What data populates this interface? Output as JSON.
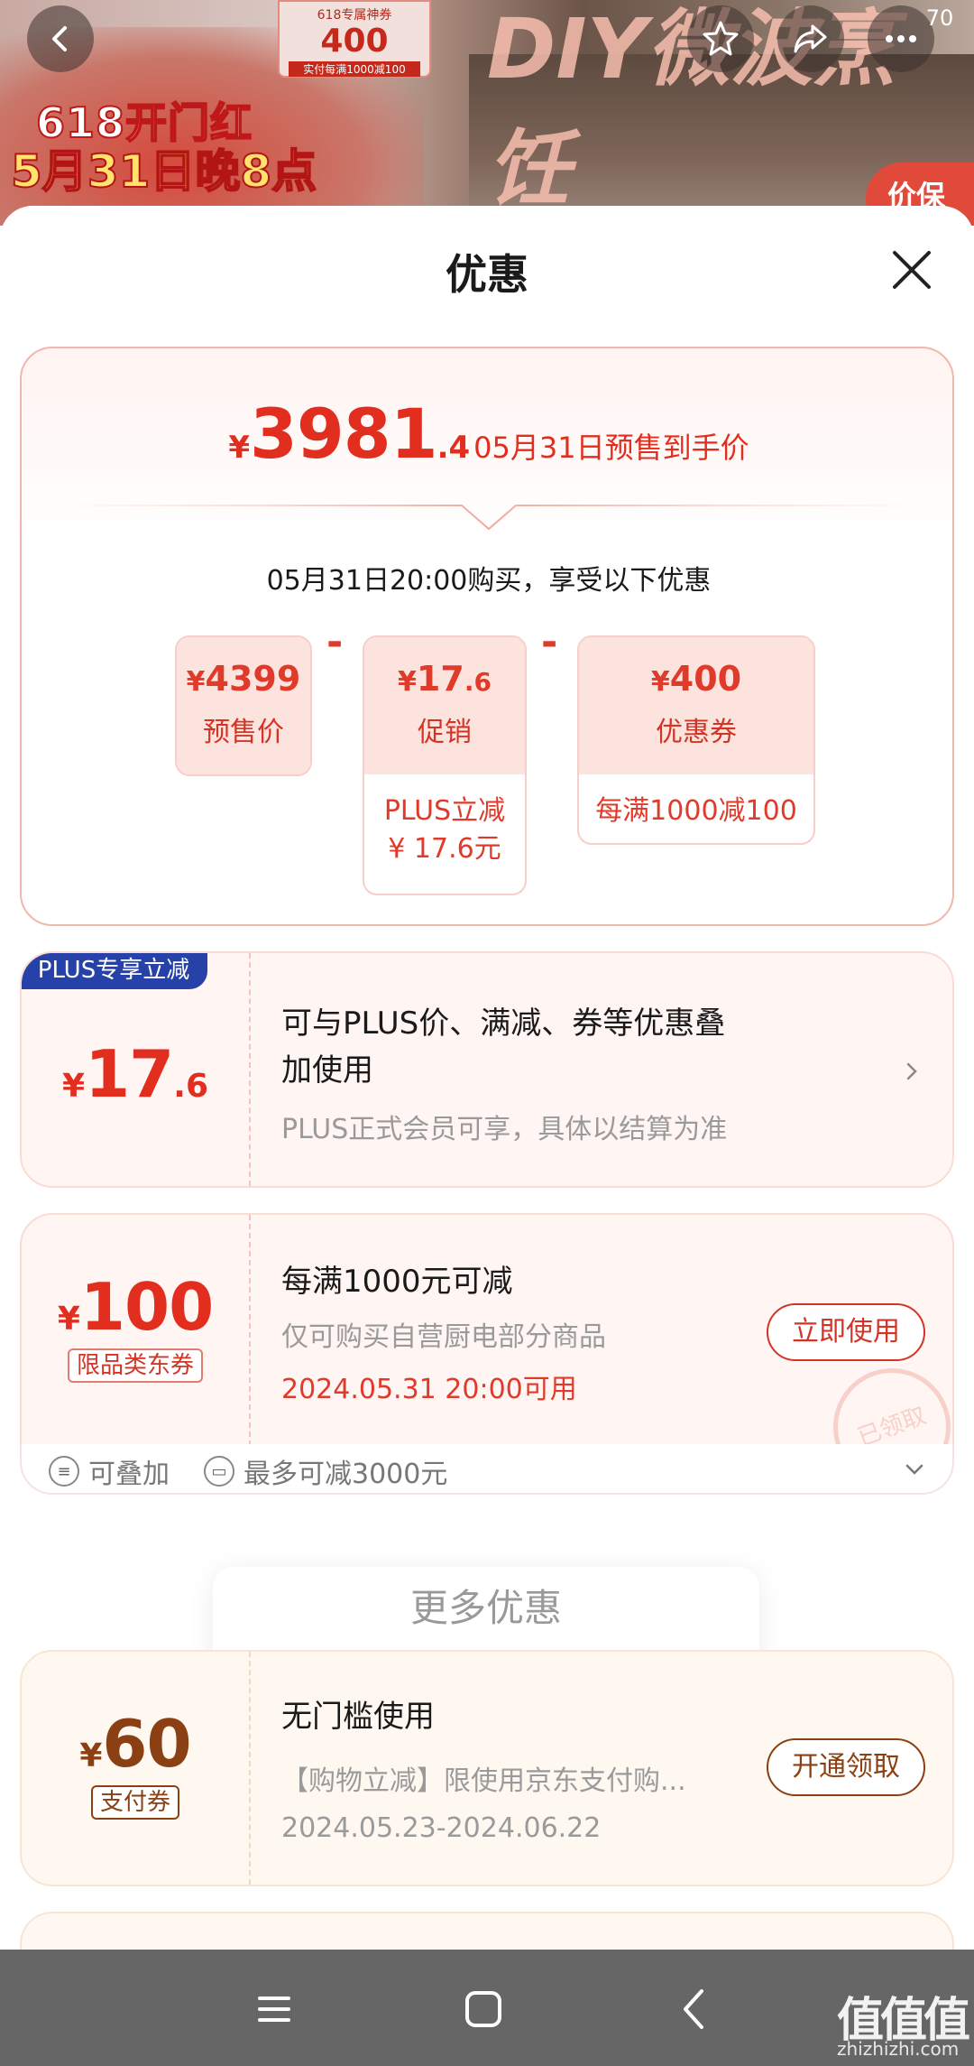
{
  "banner": {
    "promo_tag_top": "618专属神券",
    "promo_tag_amount": "400",
    "promo_tag_bottom": "实付每满1000减100",
    "line1": "618开门红",
    "line2": "5月31日晚8点",
    "big_text": "DIY微波烹饪",
    "guarantee": "价保",
    "badge": "70"
  },
  "sheet": {
    "title": "优惠"
  },
  "summary": {
    "currency": "¥",
    "price_int": "3981",
    "price_dec": ".4",
    "price_label": "05月31日预售到手价",
    "buy_desc": "05月31日20:00购买，享受以下优惠",
    "items": [
      {
        "amount": "4399",
        "dec": "",
        "name": "预售价",
        "note": ""
      },
      {
        "amount": "17",
        "dec": ".6",
        "name": "促销",
        "note": "PLUS立减",
        "note2": "¥ 17.6元"
      },
      {
        "amount": "400",
        "dec": "",
        "name": "优惠券",
        "note": "每满1000减100"
      }
    ],
    "minus": "-"
  },
  "plus_card": {
    "tag": "PLUS专享立减",
    "currency": "¥",
    "amount": "17",
    "dec": ".6",
    "title_line1": "可与PLUS价、满减、券等优惠叠",
    "title_line2": "加使用",
    "sub": "PLUS正式会员可享，具体以结算为准"
  },
  "coupon_card": {
    "currency": "¥",
    "amount": "100",
    "tag": "限品类东券",
    "title": "每满1000元可减",
    "sub": "仅可购买自营厨电部分商品",
    "avail": "2024.05.31 20:00可用",
    "button": "立即使用",
    "stamp": "已领取",
    "stack": "可叠加",
    "max": "最多可减3000元"
  },
  "more": {
    "label": "更多优惠"
  },
  "pay_card": {
    "currency": "¥",
    "amount": "60",
    "tag": "支付券",
    "title": "无门槛使用",
    "sub": "【购物立减】限使用京东支付购...",
    "validity": "2024.05.23-2024.06.22",
    "button": "开通领取"
  },
  "watermark": {
    "main": "值值值",
    "domain": "zhizhizhi.com"
  },
  "colors": {
    "accent": "#e22e1f",
    "plus_blue": "#2641a8",
    "pay_brown": "#8a4012",
    "navbar": "#666666"
  }
}
